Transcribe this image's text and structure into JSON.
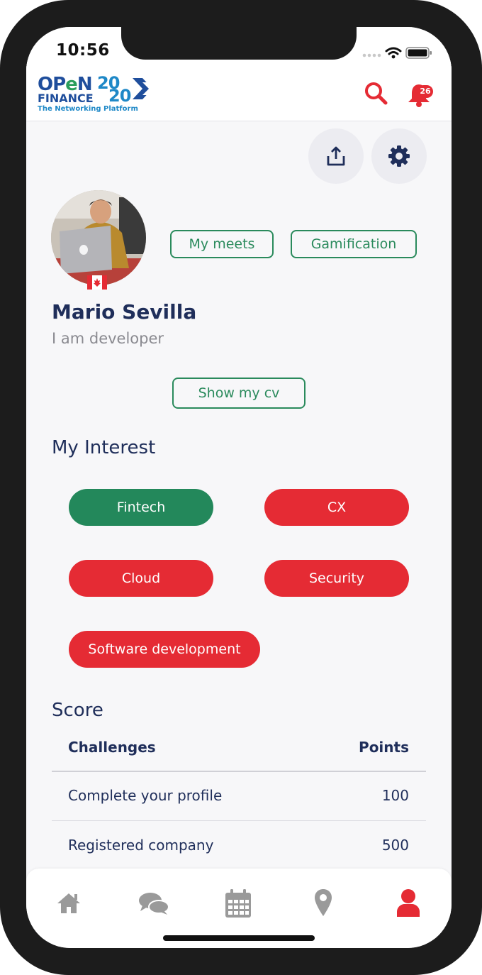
{
  "status_bar": {
    "time": "10:56"
  },
  "header": {
    "logo": {
      "line1": "OPeN",
      "line2": "FINANCE",
      "number_top": "20",
      "number_bottom": "20",
      "tagline": "The Networking Platform"
    },
    "notification_count": "26",
    "icons": {
      "search": "search-icon",
      "notifications": "bell-icon"
    }
  },
  "actions": {
    "share_icon": "share-icon",
    "settings_icon": "gear-icon"
  },
  "profile": {
    "name": "Mario Sevilla",
    "role": "I am developer",
    "flag": "canada-flag",
    "my_meets_label": "My meets",
    "gamification_label": "Gamification",
    "show_cv_label": "Show my cv"
  },
  "interests": {
    "title": "My Interest",
    "items": [
      {
        "label": "Fintech",
        "color": "#23885b"
      },
      {
        "label": "CX",
        "color": "#e52b34"
      },
      {
        "label": "Cloud",
        "color": "#e52b34"
      },
      {
        "label": "Security",
        "color": "#e52b34"
      },
      {
        "label": "Software development",
        "color": "#e52b34"
      }
    ]
  },
  "score": {
    "title": "Score",
    "columns": [
      "Challenges",
      "Points"
    ],
    "rows": [
      {
        "challenge": "Complete your profile",
        "points": "100"
      },
      {
        "challenge": "Registered company",
        "points": "500"
      }
    ]
  },
  "tabbar": {
    "items": [
      {
        "icon": "home-icon",
        "active": false
      },
      {
        "icon": "chat-icon",
        "active": false
      },
      {
        "icon": "calendar-icon",
        "active": false
      },
      {
        "icon": "map-pin-icon",
        "active": false
      },
      {
        "icon": "user-icon",
        "active": true
      }
    ]
  },
  "colors": {
    "accent_red": "#e52b34",
    "accent_green": "#23885b",
    "navy": "#1f2e5a"
  }
}
